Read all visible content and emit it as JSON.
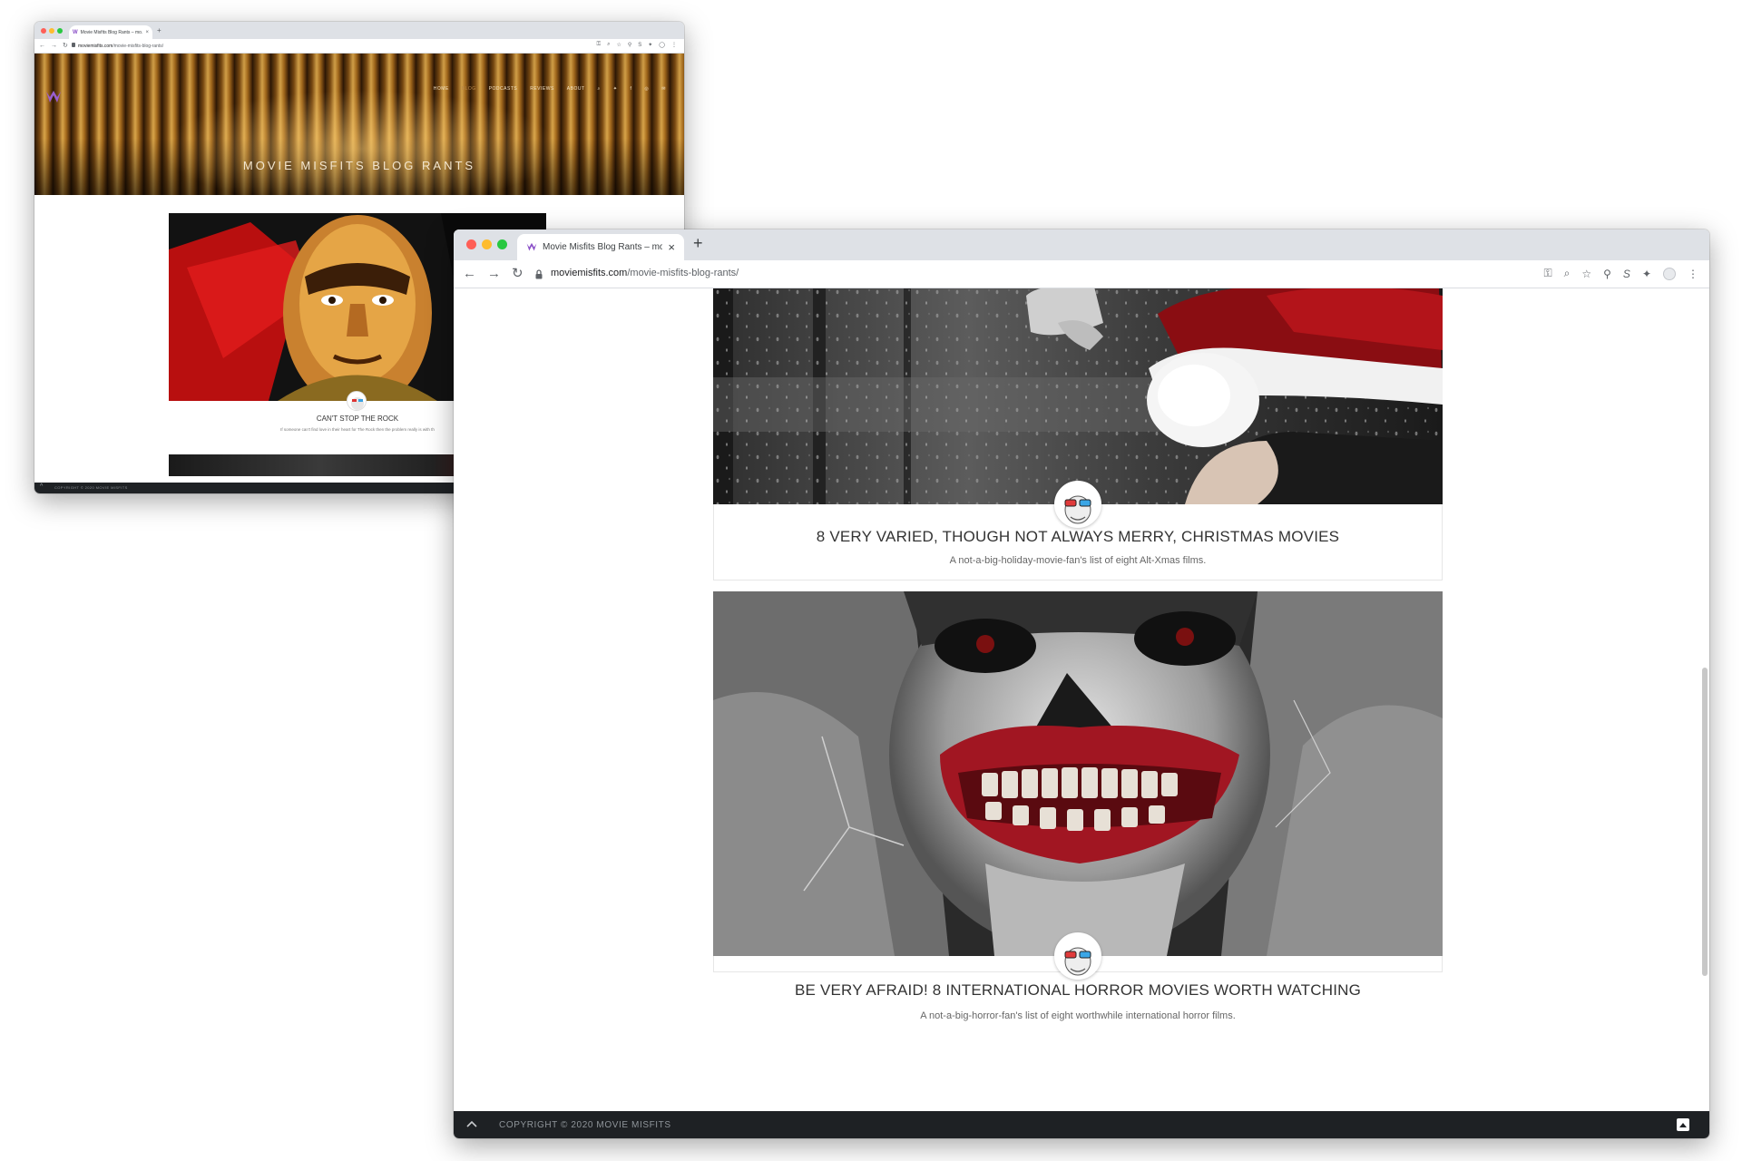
{
  "back_window": {
    "tab_title": "Movie Misfits Blog Rants – mo…",
    "url_host": "moviemisfits.com",
    "url_path": "/movie-misfits-blog-rants/",
    "nav": [
      "HOME",
      "BLOG",
      "PODCASTS",
      "REVIEWS",
      "ABOUT"
    ],
    "hero_title": "MOVIE MISFITS BLOG RANTS",
    "post_title": "CAN'T STOP THE ROCK",
    "post_excerpt": "If someone can't find love in their heart for The Rock then the problem really is with th",
    "footer": "COPYRIGHT © 2020 MOVIE MISFITS"
  },
  "front_window": {
    "tab_title": "Movie Misfits Blog Rants – mo",
    "tab_close": "×",
    "new_tab": "+",
    "url_host": "moviemisfits.com",
    "url_path": "/movie-misfits-blog-rants/",
    "posts": [
      {
        "title": "8 VERY VARIED, THOUGH NOT ALWAYS MERRY, CHRISTMAS MOVIES",
        "excerpt": "A not-a-big-holiday-movie-fan's list of eight Alt-Xmas films."
      },
      {
        "title": "BE VERY AFRAID! 8 INTERNATIONAL HORROR MOVIES WORTH WATCHING",
        "excerpt": "A not-a-big-horror-fan's list of eight worthwhile international horror films."
      }
    ],
    "footer": "COPYRIGHT © 2020 MOVIE MISFITS"
  },
  "icons": {
    "back": "arrow-left-icon",
    "forward": "arrow-right-icon",
    "reload": "reload-icon",
    "lock": "lock-icon",
    "key": "key-icon",
    "zoom": "zoom-icon",
    "star": "star-icon",
    "extensions": "puzzle-icon",
    "menu": "kebab-menu-icon"
  },
  "colors": {
    "traffic_red": "#ff5f57",
    "traffic_yellow": "#febc2e",
    "traffic_green": "#28c840",
    "footer_bg": "#1e2124",
    "brand_purple": "#8a4fc7"
  }
}
